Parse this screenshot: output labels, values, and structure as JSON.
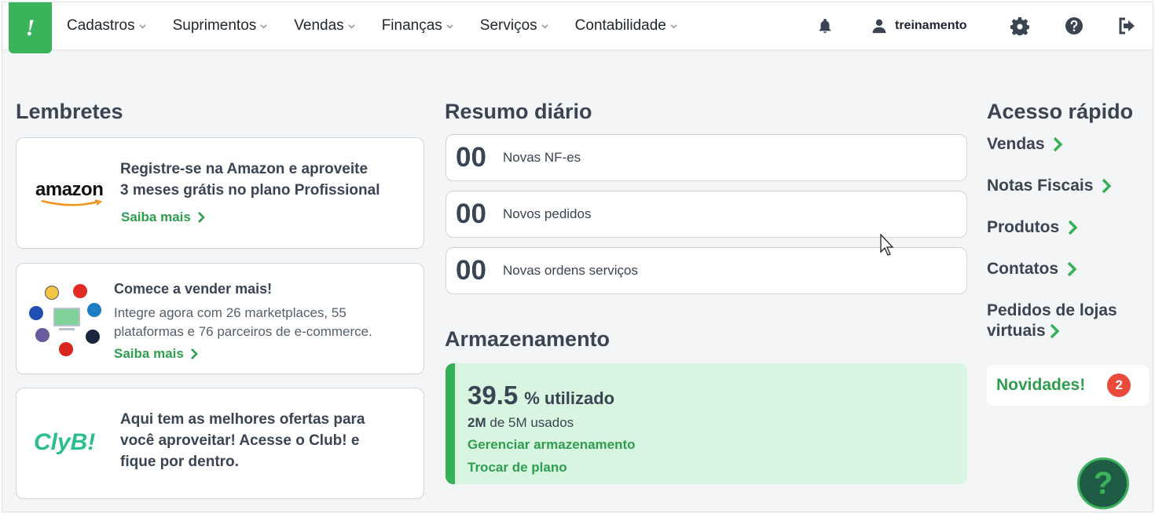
{
  "nav": {
    "items": [
      {
        "label": "Cadastros"
      },
      {
        "label": "Suprimentos"
      },
      {
        "label": "Vendas"
      },
      {
        "label": "Finanças"
      },
      {
        "label": "Serviços"
      },
      {
        "label": "Contabilidade"
      }
    ],
    "user_name": "treinamento",
    "logo_glyph": "!"
  },
  "lembretes": {
    "title": "Lembretes",
    "amazon": {
      "brand": "amazon",
      "text_line1": "Registre-se na Amazon e aproveite",
      "text_line2": "3 meses grátis no plano Profissional",
      "link": "Saiba mais"
    },
    "marketplaces": {
      "heading": "Comece a vender mais!",
      "text_line1": "Integre agora com 26 marketplaces, 55",
      "text_line2": "plataformas e 76 parceiros de e-commerce.",
      "link": "Saiba mais"
    },
    "club": {
      "brand": "ClуB!",
      "text_line1": "Aqui tem as melhores ofertas para",
      "text_line2": "você aproveitar! Acesse o Club! e",
      "text_line3": "fique por dentro."
    }
  },
  "resumo": {
    "title": "Resumo diário",
    "items": [
      {
        "value": "00",
        "label": "Novas NF-es"
      },
      {
        "value": "00",
        "label": "Novos pedidos"
      },
      {
        "value": "00",
        "label": "Novas ordens serviços"
      }
    ]
  },
  "armazenamento": {
    "title": "Armazenamento",
    "percent": "39.5",
    "percent_suffix": "% utilizado",
    "used": "2M",
    "used_suffix": "de 5M usados",
    "manage_link": "Gerenciar armazenamento",
    "plan_link": "Trocar de plano"
  },
  "acesso": {
    "title": "Acesso rápido",
    "links": [
      {
        "label": "Vendas"
      },
      {
        "label": "Notas Fiscais"
      },
      {
        "label": "Produtos"
      },
      {
        "label": "Contatos"
      },
      {
        "label_line1": "Pedidos de lojas",
        "label_line2": "virtuais"
      }
    ],
    "novidades": "Novidades!",
    "novidades_count": "2"
  },
  "help_glyph": "?",
  "colors": {
    "brand_green": "#3bb35a",
    "link_green": "#2e9e4e",
    "storage_bg": "#d8f5e1",
    "badge_red": "#e94a3a",
    "text_dark": "#3a4452"
  }
}
